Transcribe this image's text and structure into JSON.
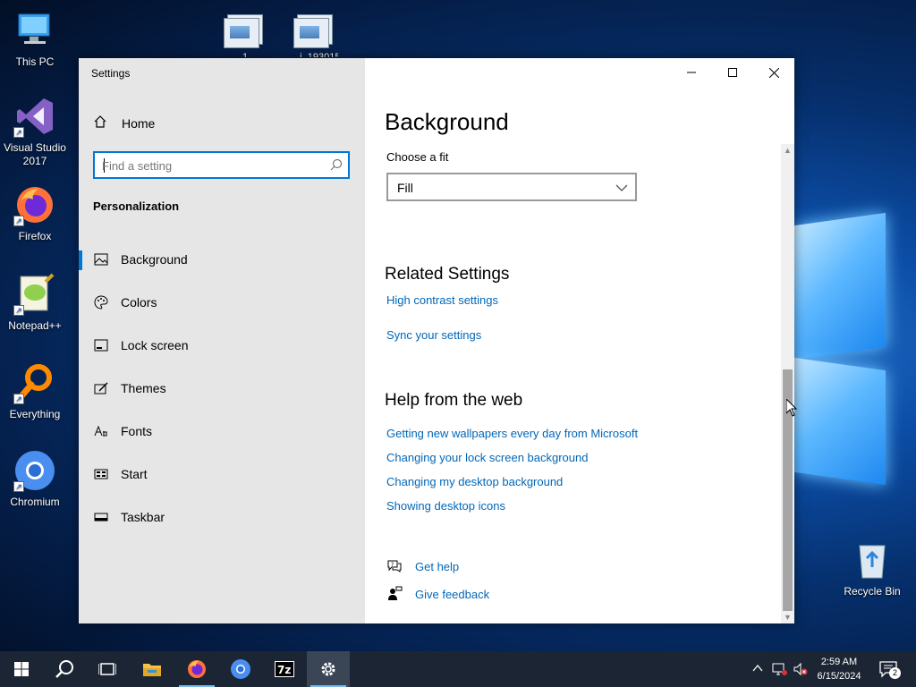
{
  "desktop": {
    "icons": [
      {
        "label": "This PC"
      },
      {
        "label": "Visual Studio 2017"
      },
      {
        "label": "Firefox"
      },
      {
        "label": "Notepad++"
      },
      {
        "label": "Everything"
      },
      {
        "label": "Chromium"
      },
      {
        "label": "Recycle Bin"
      }
    ],
    "top_files": [
      {
        "label": "1"
      },
      {
        "label": "...i_193015"
      }
    ]
  },
  "window": {
    "title": "Settings",
    "controls": {
      "minimize": "minimize",
      "maximize": "maximize",
      "close": "close"
    }
  },
  "nav": {
    "home_label": "Home",
    "search_placeholder": "Find a setting",
    "section_heading": "Personalization",
    "items": [
      {
        "label": "Background",
        "icon": "picture-icon",
        "active": true
      },
      {
        "label": "Colors",
        "icon": "palette-icon"
      },
      {
        "label": "Lock screen",
        "icon": "lock-screen-icon"
      },
      {
        "label": "Themes",
        "icon": "themes-icon"
      },
      {
        "label": "Fonts",
        "icon": "fonts-icon"
      },
      {
        "label": "Start",
        "icon": "start-icon"
      },
      {
        "label": "Taskbar",
        "icon": "taskbar-icon"
      }
    ]
  },
  "content": {
    "page_title": "Background",
    "fit_label": "Choose a fit",
    "fit_value": "Fill",
    "related_heading": "Related Settings",
    "related_links": [
      "High contrast settings",
      "Sync your settings"
    ],
    "help_heading": "Help from the web",
    "help_links": [
      "Getting new wallpapers every day from Microsoft",
      "Changing your lock screen background",
      "Changing my desktop background",
      "Showing desktop icons"
    ],
    "get_help": "Get help",
    "give_feedback": "Give feedback"
  },
  "taskbar": {
    "time": "2:59 AM",
    "date": "6/15/2024",
    "notification_count": "2",
    "apps": [
      "start",
      "search",
      "task-view",
      "file-explorer",
      "firefox",
      "chromium",
      "7zip",
      "settings"
    ]
  },
  "colors": {
    "accent": "#0078d7",
    "link": "#0067b8",
    "nav_bg": "#e6e6e6",
    "taskbar_bg": "#1c2533"
  }
}
